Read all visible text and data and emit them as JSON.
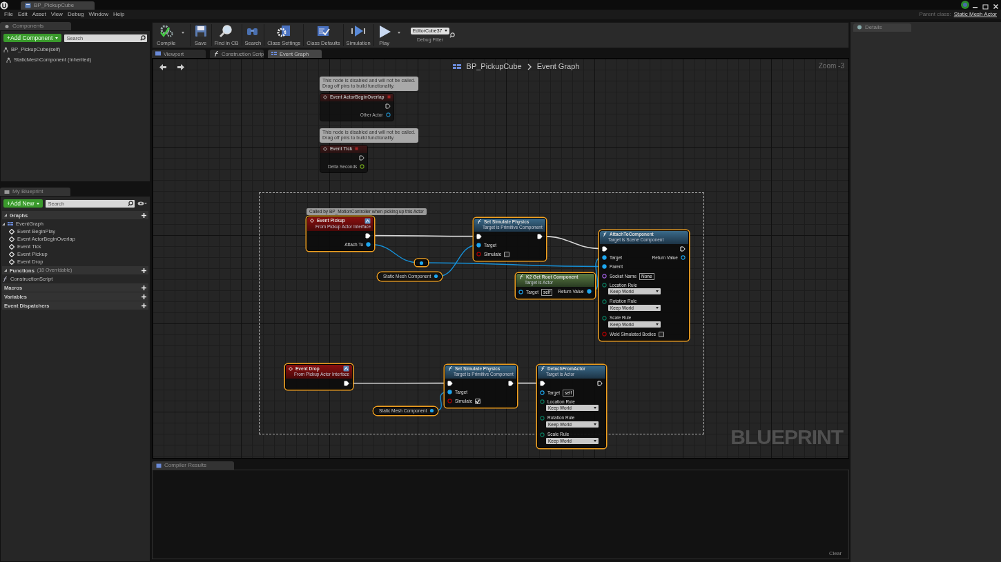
{
  "title_bar": {
    "tab": "BP_PickupCube"
  },
  "menu": [
    "File",
    "Edit",
    "Asset",
    "View",
    "Debug",
    "Window",
    "Help"
  ],
  "parent_class": {
    "label": "Parent class:",
    "value": "Static Mesh Actor"
  },
  "components": {
    "tab": "Components",
    "add_button": "+Add Component",
    "search": {
      "placeholder": "Search"
    },
    "items": [
      {
        "label": "BP_PickupCube(self)",
        "children": [
          {
            "label": "StaticMeshComponent (Inherited)"
          }
        ]
      }
    ]
  },
  "my_blueprint": {
    "tab": "My Blueprint",
    "add_button": "+Add New",
    "search": {
      "placeholder": "Search"
    },
    "sections": [
      {
        "label": "Graphs",
        "expanded": true,
        "items": [
          {
            "label": "EventGraph",
            "kind": "graph",
            "children": [
              {
                "label": "Event BeginPlay",
                "kind": "event"
              },
              {
                "label": "Event ActorBeginOverlap",
                "kind": "event"
              },
              {
                "label": "Event Tick",
                "kind": "event"
              },
              {
                "label": "Event Pickup",
                "kind": "event"
              },
              {
                "label": "Event Drop",
                "kind": "event"
              }
            ]
          }
        ]
      },
      {
        "label": "Functions",
        "note": "(18 Overridable)",
        "expanded": true,
        "items": [
          {
            "label": "ConstructionScript",
            "kind": "function"
          }
        ]
      },
      {
        "label": "Macros",
        "expanded": false
      },
      {
        "label": "Variables",
        "expanded": false
      },
      {
        "label": "Event Dispatchers",
        "expanded": false
      }
    ]
  },
  "toolbar": {
    "buttons": [
      {
        "label": "Compile",
        "kind": "compile",
        "dropdown": true
      },
      {
        "label": "Save",
        "kind": "save",
        "dropdown": false
      },
      {
        "label": "Find in CB",
        "kind": "find",
        "dropdown": false
      },
      {
        "label": "Search",
        "kind": "search",
        "dropdown": false
      },
      {
        "label": "Class Settings",
        "kind": "settings",
        "dropdown": false
      },
      {
        "label": "Class Defaults",
        "kind": "defaults",
        "dropdown": false
      },
      {
        "label": "Simulation",
        "kind": "simulation",
        "dropdown": false
      },
      {
        "label": "Play",
        "kind": "play",
        "dropdown": true
      }
    ],
    "debug_filter": {
      "value": "EditorCube37",
      "label": "Debug Filter"
    }
  },
  "editor_tabs": [
    {
      "label": "Viewport",
      "selected": false
    },
    {
      "label": "Construction Scrip",
      "selected": false
    },
    {
      "label": "Event Graph",
      "selected": true
    }
  ],
  "graph": {
    "breadcrumb": [
      "BP_PickupCube",
      "Event Graph"
    ],
    "zoom": "Zoom -3",
    "watermark": "BLUEPRINT",
    "nodes": [
      {
        "kind": "disabled",
        "selected": false,
        "comment": "This node is disabled and will not be called.\nDrag off pins to build functionality.",
        "title": "Event ActorBeginOverlap",
        "rows": [
          {
            "right": {
              "kind": "exec",
              "linked": false
            }
          },
          {
            "right": {
              "kind": "object",
              "label": "Other Actor",
              "linked": false
            }
          }
        ]
      },
      {
        "kind": "disabled",
        "selected": false,
        "comment": "This node is disabled and will not be called.\nDrag off pins to build functionality.",
        "title": "Event Tick",
        "rows": [
          {
            "right": {
              "kind": "exec",
              "linked": false
            }
          },
          {
            "right": {
              "kind": "float",
              "label": "Delta Seconds",
              "linked": false
            }
          }
        ]
      },
      {
        "kind": "event",
        "selected": true,
        "comment": "Called by BP_MotionController when picking up this Actor",
        "title": "Event Pickup",
        "subtitle": "From Pickup Actor Interface",
        "rows": [
          {
            "right": {
              "kind": "exec",
              "linked": true
            }
          },
          {
            "right": {
              "kind": "object",
              "label": "Attach To",
              "linked": true
            }
          }
        ]
      },
      {
        "kind": "function",
        "selected": true,
        "title": "Set Simulate Physics",
        "subtitle": "Target is Primitive Component",
        "rows": [
          {
            "left": {
              "kind": "exec",
              "linked": true
            },
            "right": {
              "kind": "exec",
              "linked": true
            }
          },
          {
            "left": {
              "kind": "object",
              "label": "Target",
              "linked": true
            }
          },
          {
            "left": {
              "kind": "bool",
              "label": "Simulate",
              "checked": false,
              "linked": false
            }
          }
        ]
      },
      {
        "kind": "reroute",
        "selected": true
      },
      {
        "kind": "variable",
        "selected": true,
        "title": "Static Mesh Component"
      },
      {
        "kind": "pure",
        "selected": true,
        "title": "K2 Get Root Component",
        "subtitle": "Target is Actor",
        "rows": [
          {
            "left": {
              "kind": "object",
              "label": "Target",
              "value": "self",
              "linked": false
            },
            "right": {
              "kind": "object",
              "label": "Return Value",
              "linked": true
            }
          }
        ]
      },
      {
        "kind": "function",
        "selected": true,
        "title": "AttachToComponent",
        "subtitle": "Target is Scene Component",
        "rows": [
          {
            "left": {
              "kind": "exec",
              "linked": true
            },
            "right": {
              "kind": "exec",
              "linked": false
            }
          },
          {
            "left": {
              "kind": "object",
              "label": "Target",
              "linked": true
            },
            "right": {
              "kind": "object",
              "label": "Return Value",
              "linked": false
            }
          },
          {
            "left": {
              "kind": "object",
              "label": "Parent",
              "linked": true
            }
          },
          {
            "left": {
              "kind": "name",
              "label": "Socket Name",
              "value": "None",
              "linked": false
            }
          },
          {
            "left": {
              "kind": "enum",
              "label": "Location Rule",
              "value": "Keep World",
              "linked": false
            }
          },
          {
            "left": {
              "kind": "enum",
              "label": "Rotation Rule",
              "value": "Keep World",
              "linked": false
            }
          },
          {
            "left": {
              "kind": "enum",
              "label": "Scale Rule",
              "value": "Keep World",
              "linked": false
            }
          },
          {
            "left": {
              "kind": "bool",
              "label": "Weld Simulated Bodies",
              "checked": false,
              "linked": false
            }
          }
        ]
      },
      {
        "kind": "event",
        "selected": true,
        "title": "Event Drop",
        "subtitle": "From Pickup Actor Interface",
        "rows": [
          {
            "right": {
              "kind": "exec",
              "linked": true
            }
          }
        ]
      },
      {
        "kind": "function",
        "selected": true,
        "title": "Set Simulate Physics",
        "subtitle": "Target is Primitive Component",
        "rows": [
          {
            "left": {
              "kind": "exec",
              "linked": true
            },
            "right": {
              "kind": "exec",
              "linked": true
            }
          },
          {
            "left": {
              "kind": "object",
              "label": "Target",
              "linked": true
            }
          },
          {
            "left": {
              "kind": "bool",
              "label": "Simulate",
              "checked": true,
              "linked": false
            }
          }
        ]
      },
      {
        "kind": "variable",
        "selected": true,
        "title": "Static Mesh Component"
      },
      {
        "kind": "function",
        "selected": true,
        "title": "DetachFromActor",
        "subtitle": "Target is Actor",
        "rows": [
          {
            "left": {
              "kind": "exec",
              "linked": true
            },
            "right": {
              "kind": "exec",
              "linked": false
            }
          },
          {
            "left": {
              "kind": "object",
              "label": "Target",
              "value": "self",
              "linked": false
            }
          },
          {
            "left": {
              "kind": "enum",
              "label": "Location Rule",
              "value": "Keep World",
              "linked": false
            }
          },
          {
            "left": {
              "kind": "enum",
              "label": "Rotation Rule",
              "value": "Keep World",
              "linked": false
            }
          },
          {
            "left": {
              "kind": "enum",
              "label": "Scale Rule",
              "value": "Keep World",
              "linked": false
            }
          }
        ]
      }
    ]
  },
  "compiler_results": {
    "tab": "Compiler Results",
    "clear_button": "Clear"
  },
  "details": {
    "tab": "Details"
  }
}
